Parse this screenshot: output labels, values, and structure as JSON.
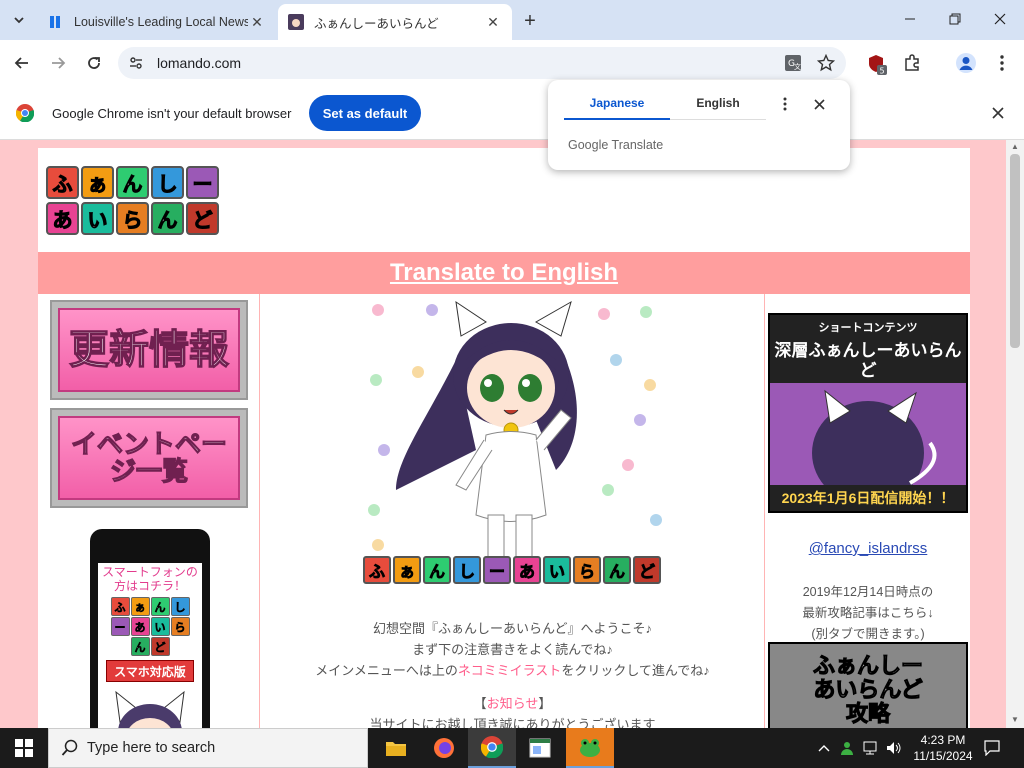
{
  "browser": {
    "tabs": [
      {
        "title": "Louisville's Leading Local News",
        "active": false
      },
      {
        "title": "ふぁんしーあいらんど",
        "active": true
      }
    ],
    "new_tab_label": "+",
    "url": "lomando.com"
  },
  "infobar": {
    "message": "Google Chrome isn't your default browser",
    "button": "Set as default"
  },
  "translate_popup": {
    "lang_source": "Japanese",
    "lang_target": "English",
    "branding": "Google Translate"
  },
  "page": {
    "logo_top": [
      "ふ",
      "ぁ",
      "ん",
      "し",
      "ー"
    ],
    "logo_bottom": [
      "あ",
      "い",
      "ら",
      "ん",
      "ど"
    ],
    "translate_link": "Translate to English",
    "menu": [
      {
        "label": "更新情報"
      },
      {
        "label": "イベントページ一覧"
      }
    ],
    "phone": {
      "promo": "スマートフォンの方はコチラ！",
      "tiles_top": [
        "ふ",
        "ぁ",
        "ん",
        "し",
        "ー"
      ],
      "tiles_bottom": [
        "あ",
        "い",
        "ら",
        "ん",
        "ど"
      ],
      "label": "スマホ対応版"
    },
    "hero_tiles": [
      "ふ",
      "ぁ",
      "ん",
      "し",
      "ー",
      "あ",
      "い",
      "ら",
      "ん",
      "ど"
    ],
    "intro": {
      "line1": "幻想空間『ふぁんしーあいらんど』へようこそ♪",
      "line2": "まず下の注意書きをよく読んでね♪",
      "line3_pre": "メインメニューへは上の",
      "line3_link": "ネコミミイラスト",
      "line3_post": "をクリックして進んでね♪",
      "notice_open": "【",
      "notice_label": "お知らせ",
      "notice_close": "】",
      "line5": "当サイトにお越し頂き誠にありがとうございます"
    },
    "banner": {
      "top": "ショートコンテンツ",
      "title": "深層ふぁんしーあいらんど",
      "date": "2023年1月6日配信開始！！"
    },
    "twitter": "@fancy_islandrss",
    "strat_note": {
      "line1": "2019年12月14日時点の",
      "line2": "最新攻略記事はこちら↓",
      "line3": "(別タブで開きます。)"
    },
    "strat_banner": {
      "line1": "ふぁんしー",
      "line2": "あいらんど",
      "line3": "攻略"
    }
  },
  "taskbar": {
    "search_placeholder": "Type here to search",
    "time": "4:23 PM",
    "date": "11/15/2024"
  },
  "colors": {
    "page_bg": "#fec8cb",
    "translate_bar": "#ff9e9e",
    "accent_blue": "#0b57d0"
  }
}
